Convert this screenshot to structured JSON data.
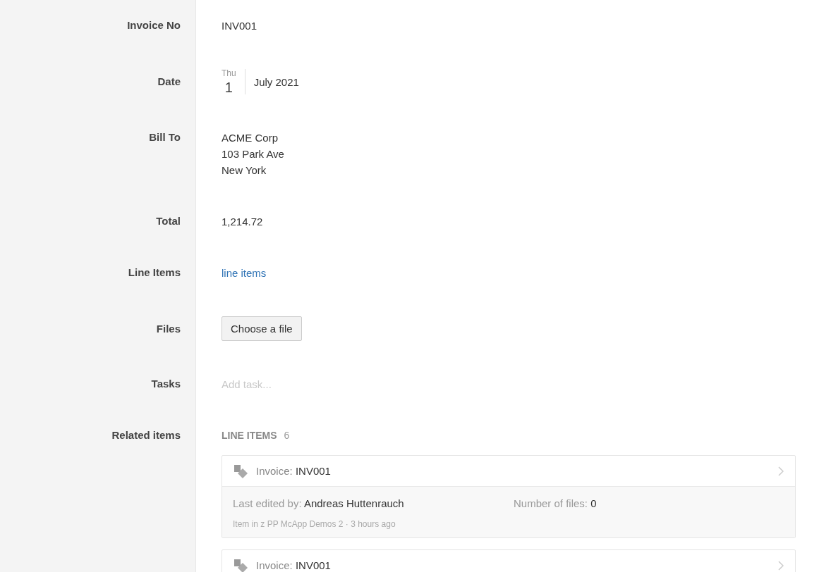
{
  "fields": [
    {
      "label": "Invoice No",
      "kind": "text",
      "value": "INV001"
    },
    {
      "label": "Date",
      "kind": "date",
      "weekday": "Thu",
      "day": "1",
      "month": "July 2021"
    },
    {
      "label": "Bill To",
      "kind": "multiline",
      "lines": [
        "ACME Corp",
        "103 Park Ave",
        "New York"
      ]
    },
    {
      "label": "Total",
      "kind": "text",
      "value": "1,214.72"
    },
    {
      "label": "Line Items",
      "kind": "link",
      "value": "line items"
    },
    {
      "label": "Files",
      "kind": "file",
      "button": "Choose a file"
    },
    {
      "label": "Tasks",
      "kind": "task",
      "placeholder": "Add task..."
    },
    {
      "label": "Related items",
      "kind": "related",
      "heading": "LINE ITEMS",
      "count": "6",
      "cards": [
        {
          "title_label": "Invoice:",
          "title_value": "INV001",
          "details": {
            "editor_label": "Last edited by:",
            "editor": "Andreas Huttenrauch",
            "files_label": "Number of files:",
            "files": "0",
            "meta": "Item in z PP McApp Demos 2 · 3 hours ago"
          }
        },
        {
          "title_label": "Invoice:",
          "title_value": "INV001"
        }
      ]
    }
  ]
}
